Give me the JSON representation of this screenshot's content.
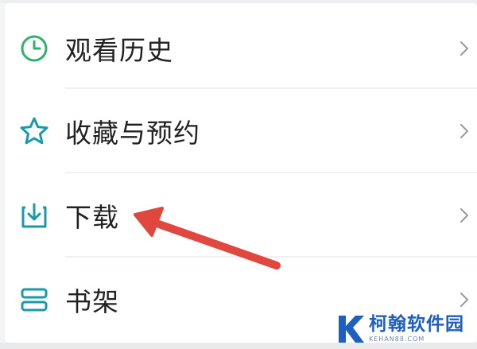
{
  "menu": {
    "items": [
      {
        "label": "观看历史",
        "icon": "clock-icon"
      },
      {
        "label": "收藏与预约",
        "icon": "star-icon"
      },
      {
        "label": "下载",
        "icon": "download-icon"
      },
      {
        "label": "书架",
        "icon": "bookshelf-icon"
      }
    ],
    "chevron_icon": "chevron-right-icon"
  },
  "colors": {
    "history_icon": "#2fb36a",
    "teal_icon": "#1a9aa8",
    "arrow": "#e0483f",
    "chevron": "#9a9a9a",
    "watermark": "#1f5fbf"
  },
  "annotation": {
    "type": "red-arrow-pointer",
    "target": "下载"
  },
  "watermark": {
    "name": "柯翰软件园",
    "url": "KEHAN88.COM"
  }
}
